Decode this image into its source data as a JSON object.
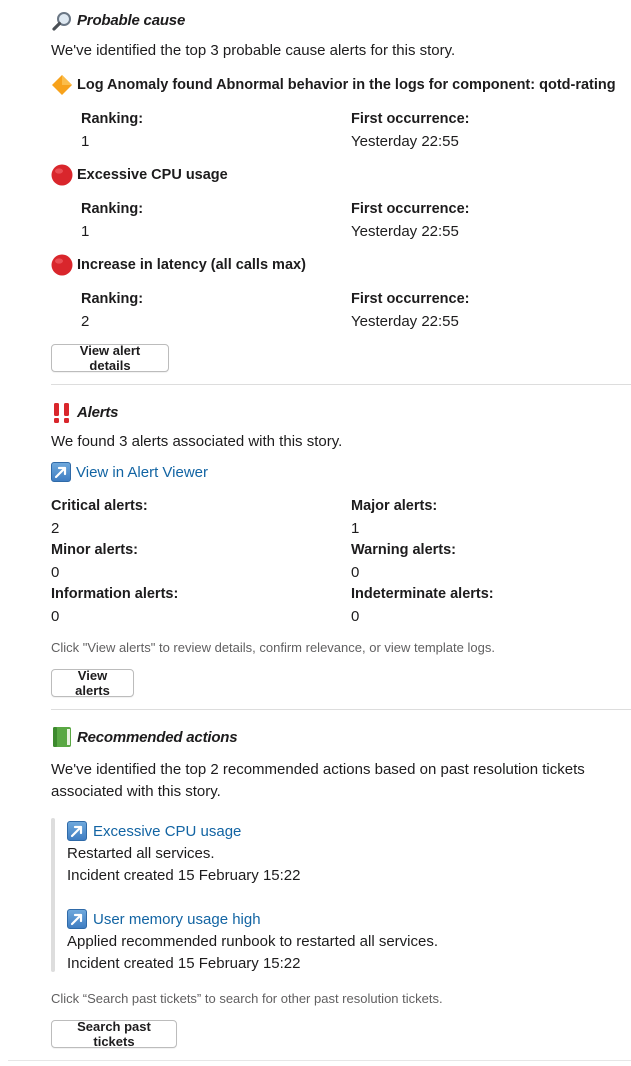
{
  "probable_cause": {
    "title": "Probable cause",
    "intro": "We've identified the top 3 probable cause alerts for this story.",
    "alerts": [
      {
        "name": "Log Anomaly found Abnormal behavior in the logs for component: qotd-rating",
        "ranking_label": "Ranking:",
        "ranking": "1",
        "first_label": "First occurrence:",
        "first": "Yesterday 22:55"
      },
      {
        "name": "Excessive CPU usage",
        "ranking_label": "Ranking:",
        "ranking": "1",
        "first_label": "First occurrence:",
        "first": "Yesterday 22:55"
      },
      {
        "name": "Increase in latency (all calls max)",
        "ranking_label": "Ranking:",
        "ranking": "2",
        "first_label": "First occurrence:",
        "first": "Yesterday 22:55"
      }
    ],
    "button": "View alert details"
  },
  "alerts": {
    "title": "Alerts",
    "intro": "We found 3 alerts associated with this story.",
    "viewer_link": "View in Alert Viewer",
    "counts": [
      {
        "label": "Critical alerts:",
        "value": "2"
      },
      {
        "label": "Major alerts:",
        "value": "1"
      },
      {
        "label": "Minor alerts:",
        "value": "0"
      },
      {
        "label": "Warning alerts:",
        "value": "0"
      },
      {
        "label": "Information alerts:",
        "value": "0"
      },
      {
        "label": "Indeterminate alerts:",
        "value": "0"
      }
    ],
    "hint": "Click \"View alerts\" to review details, confirm relevance, or view template logs.",
    "button": "View alerts"
  },
  "recommended": {
    "title": "Recommended actions",
    "intro": "We've identified the top 2 recommended actions based on past resolution tickets associated with this story.",
    "items": [
      {
        "link": "Excessive CPU usage",
        "action": "Restarted all services.",
        "incident": "Incident created 15 February 15:22"
      },
      {
        "link": "User memory usage high",
        "action": "Applied recommended runbook to restarted all services.",
        "incident": "Incident created 15 February 15:22"
      }
    ],
    "hint": "Click “Search past tickets” to search for other past resolution tickets.",
    "button": "Search past tickets"
  },
  "colors": {
    "link": "#1264a3",
    "red_circle": "#e0282e",
    "orange_diamond": "#f7a21b",
    "alert_red": "#d9262c",
    "book_green": "#5aa844"
  }
}
